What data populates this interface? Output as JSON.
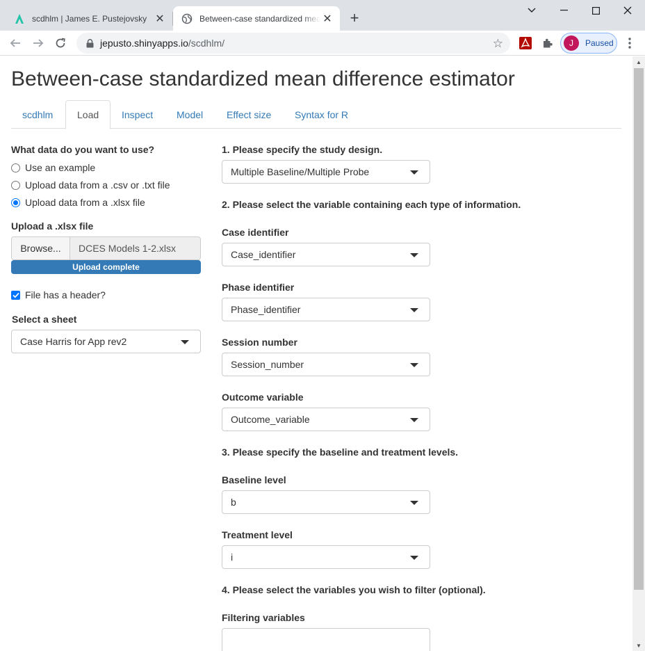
{
  "browser": {
    "tabs": [
      {
        "title": "scdhlm | James E. Pustejovsky",
        "active": false
      },
      {
        "title": "Between-case standardized mean difference estimator",
        "active": true
      }
    ],
    "url_host": "jepusto.shinyapps.io",
    "url_path": "/scdhlm/",
    "profile_initial": "J",
    "profile_label": "Paused"
  },
  "page": {
    "title": "Between-case standardized mean difference estimator",
    "tabs": [
      "scdhlm",
      "Load",
      "Inspect",
      "Model",
      "Effect size",
      "Syntax for R"
    ],
    "active_tab": "Load"
  },
  "sidebar": {
    "data_question": "What data do you want to use?",
    "options": [
      "Use an example",
      "Upload data from a .csv or .txt file",
      "Upload data from a .xlsx file"
    ],
    "selected_option": "Upload data from a .xlsx file",
    "upload_label": "Upload a .xlsx file",
    "browse_label": "Browse...",
    "file_name": "DCES Models 1-2.xlsx",
    "upload_status": "Upload complete",
    "header_checkbox_label": "File has a header?",
    "header_checked": true,
    "sheet_label": "Select a sheet",
    "sheet_value": "Case Harris for App rev2"
  },
  "main": {
    "step1": "1. Please specify the study design.",
    "design_value": "Multiple Baseline/Multiple Probe",
    "step2": "2. Please select the variable containing each type of information.",
    "case_label": "Case identifier",
    "case_value": "Case_identifier",
    "phase_label": "Phase identifier",
    "phase_value": "Phase_identifier",
    "session_label": "Session number",
    "session_value": "Session_number",
    "outcome_label": "Outcome variable",
    "outcome_value": "Outcome_variable",
    "step3": "3. Please specify the baseline and treatment levels.",
    "baseline_label": "Baseline level",
    "baseline_value": "b",
    "treatment_label": "Treatment level",
    "treatment_value": "i",
    "step4": "4. Please select the variables you wish to filter (optional).",
    "filter_label": "Filtering variables",
    "filter_value": ""
  },
  "colors": {
    "link": "#337ab7",
    "progress": "#337ab7",
    "checkbox": "#0075ff",
    "tabstrip": "#dee1e6"
  }
}
